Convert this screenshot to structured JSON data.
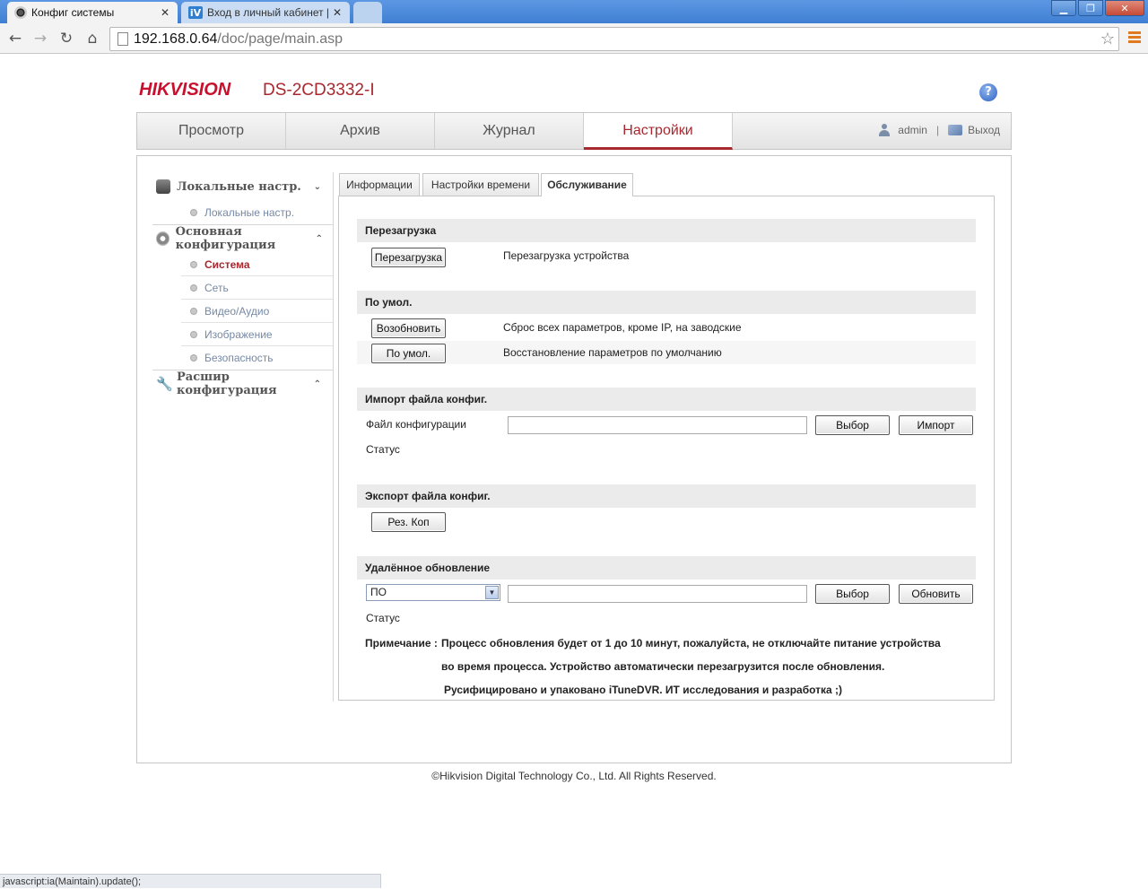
{
  "browser": {
    "tabs": [
      {
        "title": "Конфиг системы"
      },
      {
        "title": "Вход в личный кабинет | Iv"
      }
    ],
    "url_host": "192.168.0.64",
    "url_path": "/doc/page/main.asp",
    "status_text": "javascript:ia(Maintain).update();"
  },
  "header": {
    "logo": "HIKVISION",
    "model": "DS-2CD3332-I",
    "help": "?"
  },
  "mainnav": {
    "tabs": [
      "Просмотр",
      "Архив",
      "Журнал",
      "Настройки"
    ],
    "user": "admin",
    "separator": "|",
    "logout": "Выход"
  },
  "sidebar": {
    "groups": [
      {
        "label": "Локальные настр.",
        "chevron": "⌄"
      },
      {
        "label": "Основная конфигурация",
        "chevron": "⌃"
      },
      {
        "label": "Расшир конфигурация",
        "chevron": "⌃"
      }
    ],
    "items": [
      "Локальные настр.",
      "Система",
      "Сеть",
      "Видео/Аудио",
      "Изображение",
      "Безопасность"
    ]
  },
  "subtabs": [
    "Информации",
    "Настройки времени",
    "Обслуживание"
  ],
  "sections": {
    "reboot": {
      "title": "Перезагрузка",
      "button": "Перезагрузка",
      "desc": "Перезагрузка устройства"
    },
    "default": {
      "title": "По умол.",
      "restore_button": "Возобновить",
      "restore_desc": "Сброс всех параметров, кроме IP, на заводские",
      "default_button": "По умол.",
      "default_desc": "Восстановление параметров по умолчанию"
    },
    "import": {
      "title": "Импорт файла конфиг.",
      "file_label": "Файл конфигурации",
      "file_value": "",
      "browse_button": "Выбор",
      "import_button": "Импорт",
      "status_label": "Статус"
    },
    "export": {
      "title": "Экспорт файла конфиг.",
      "backup_button": "Рез. Коп"
    },
    "upgrade": {
      "title": "Удалённое обновление",
      "select_value": "ПО",
      "file_value": "",
      "browse_button": "Выбор",
      "upgrade_button": "Обновить",
      "status_label": "Статус",
      "note_label": "Примечание :",
      "note_line1": "Процесс обновления будет от 1 до 10 минут, пожалуйста, не отключайте питание устройства",
      "note_line2": "во время процесса. Устройство автоматически перезагрузится после обновления.",
      "note_line3": "Русифицировано и упаковано iTuneDVR. ИТ исследования и разработка ;)"
    }
  },
  "footer": "©Hikvision Digital Technology Co., Ltd. All Rights Reserved."
}
